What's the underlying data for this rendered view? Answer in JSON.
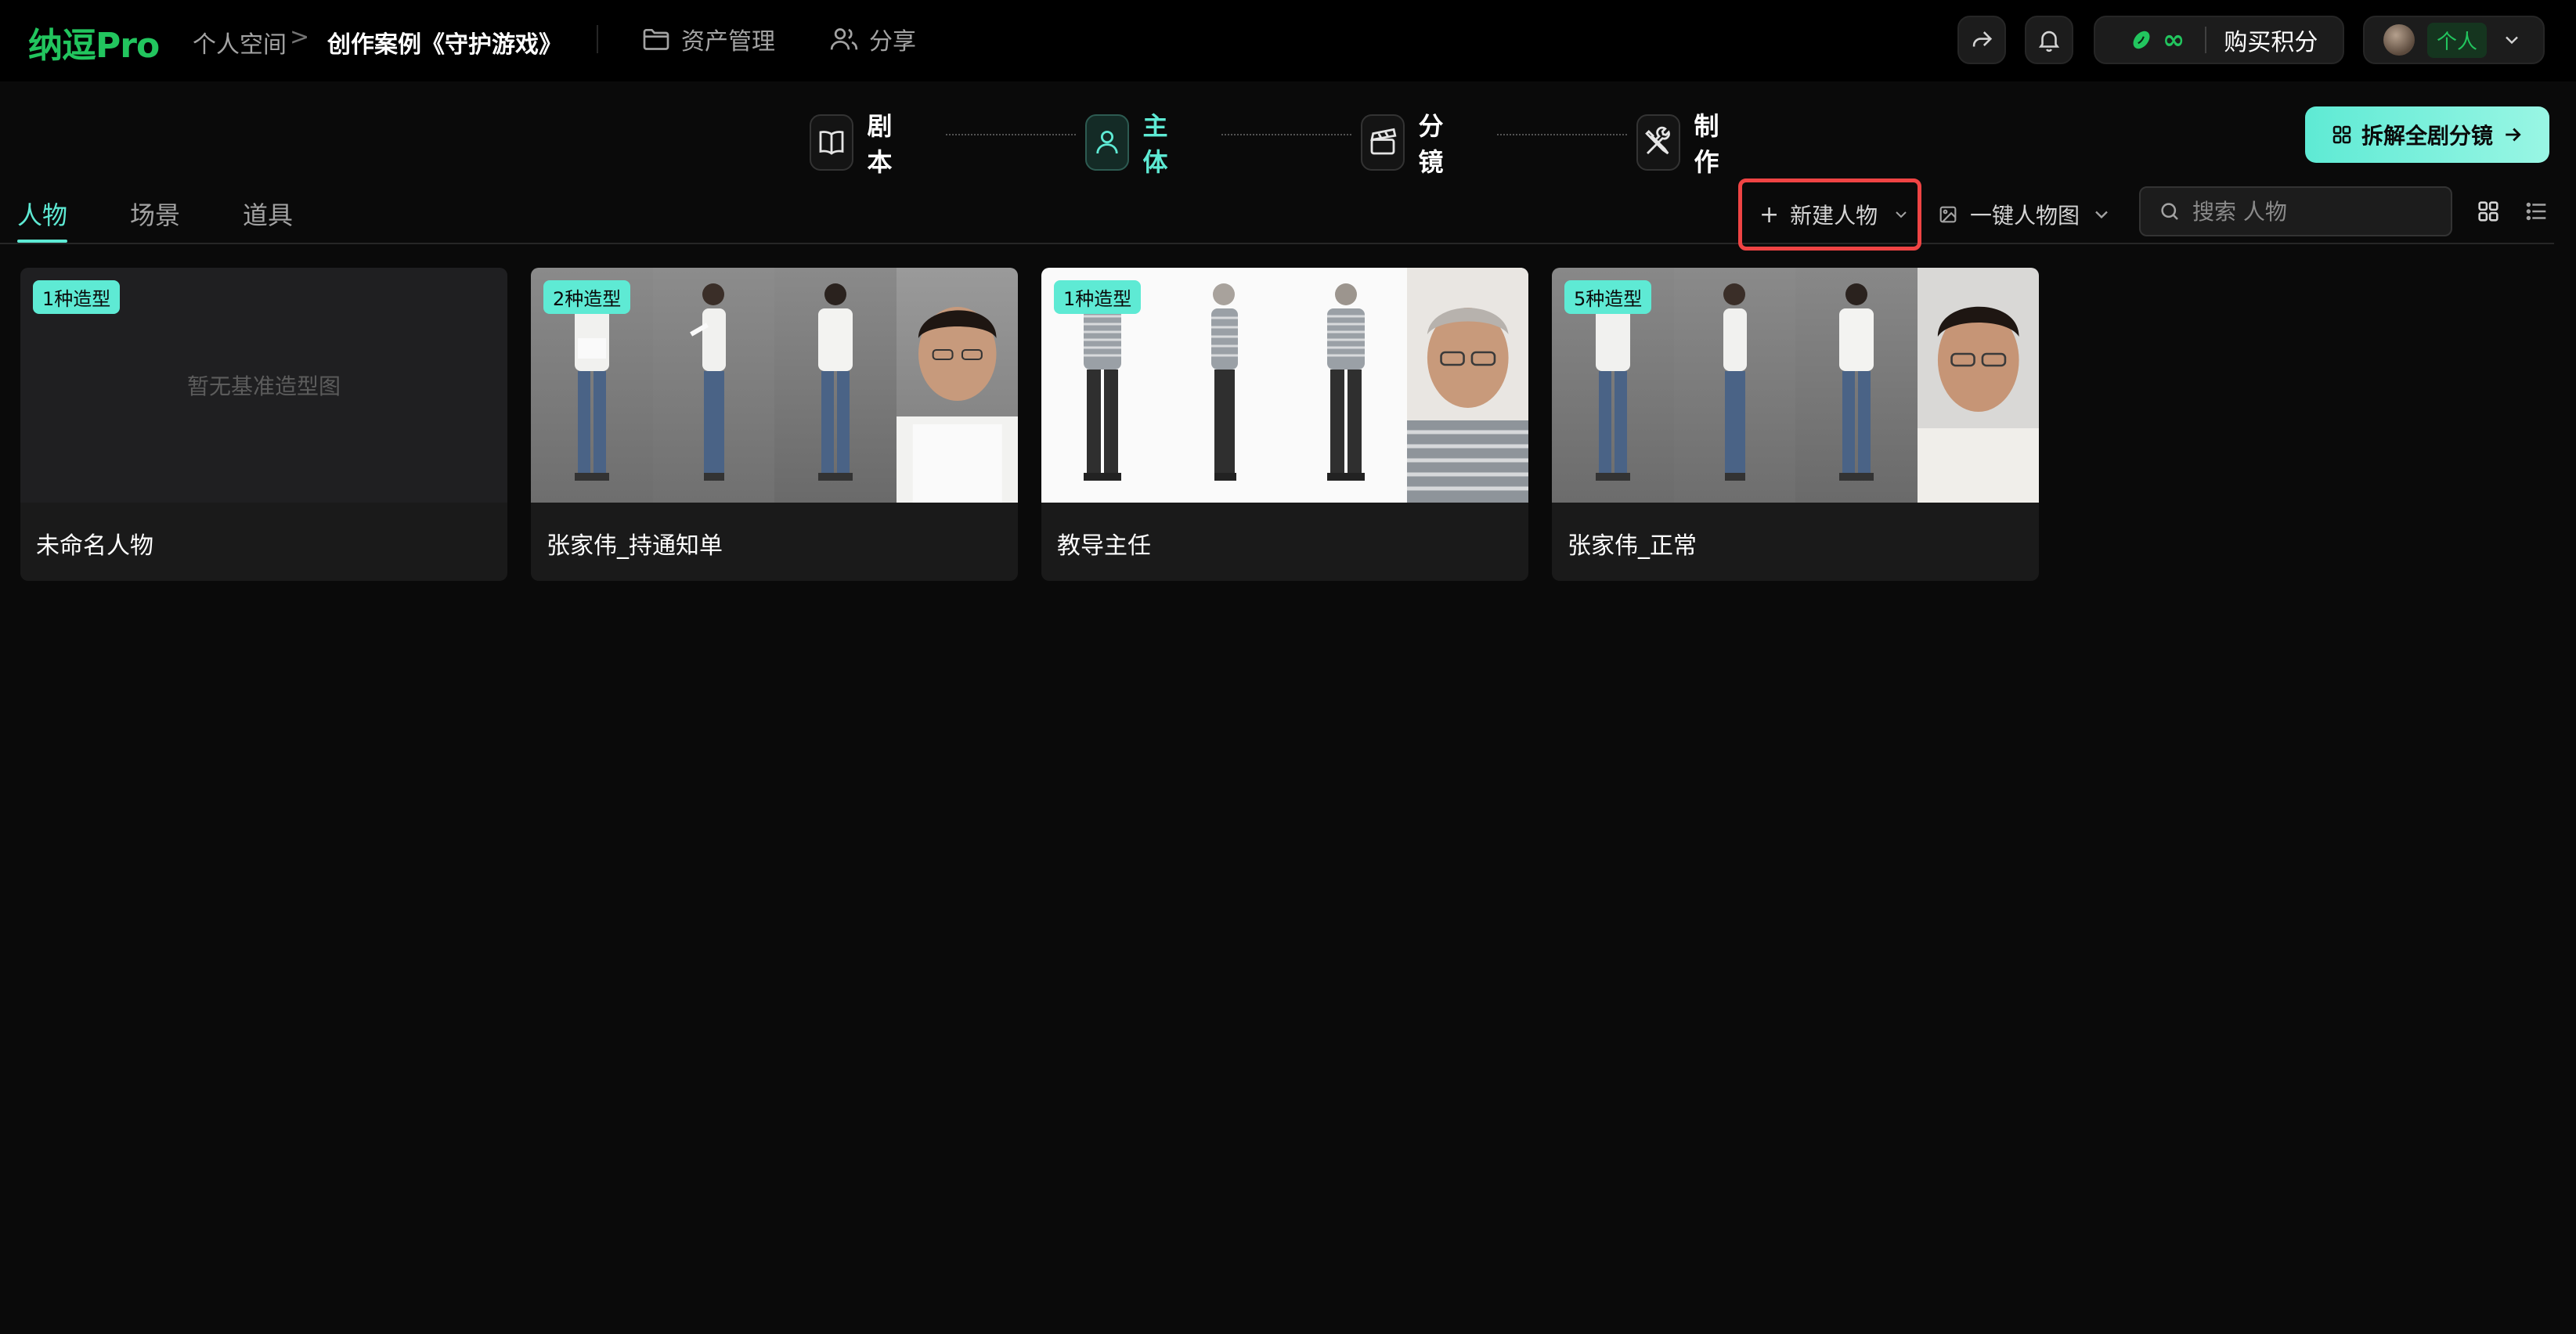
{
  "header": {
    "logo": "纳逗Pro",
    "breadcrumb": {
      "parent": "个人空间",
      "separator": ">",
      "current": "创作案例《守护游戏》"
    },
    "nav": {
      "assets": "资产管理",
      "share": "分享"
    },
    "credits": {
      "value": "∞",
      "buy_label": "购买积分"
    },
    "user": {
      "badge": "个人"
    }
  },
  "steps": [
    {
      "label": "剧本",
      "active": false
    },
    {
      "label": "主体",
      "active": true
    },
    {
      "label": "分镜",
      "active": false
    },
    {
      "label": "制作",
      "active": false
    }
  ],
  "cta": {
    "label": "拆解全剧分镜"
  },
  "tabs": [
    {
      "label": "人物",
      "active": true
    },
    {
      "label": "场景",
      "active": false
    },
    {
      "label": "道具",
      "active": false
    }
  ],
  "toolbar": {
    "new_plus": "+",
    "new_label": "新建人物",
    "oneclick_label": "一键人物图",
    "search_placeholder": "搜索 人物"
  },
  "cards": [
    {
      "tag": "1种造型",
      "name": "未命名人物",
      "empty_text": "暂无基准造型图"
    },
    {
      "tag": "2种造型",
      "name": "张家伟_持通知单"
    },
    {
      "tag": "1种造型",
      "name": "教导主任"
    },
    {
      "tag": "5种造型",
      "name": "张家伟_正常"
    }
  ],
  "colors": {
    "brand": "#22c55e",
    "accent": "#5eead4",
    "highlight": "#ef4444"
  }
}
